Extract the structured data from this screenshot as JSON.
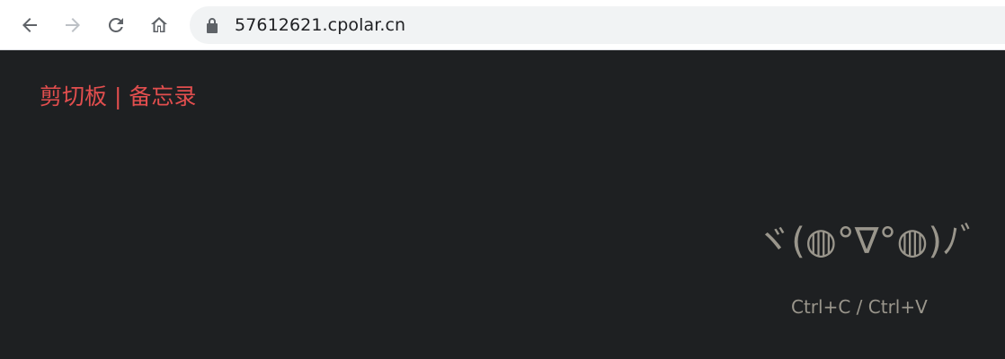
{
  "browser": {
    "url": "57612621.cpolar.cn",
    "icons": [
      "back-arrow-icon",
      "forward-arrow-icon",
      "reload-icon",
      "home-icon",
      "lock-icon"
    ]
  },
  "page": {
    "brand_title": "剪切板 | 备忘录",
    "kaomoji": "ヾ(◍°∇°◍)ﾉﾞ",
    "shortcut_hint": "Ctrl+C / Ctrl+V"
  },
  "colors": {
    "background": "#1e2022",
    "brand": "#e24e4e",
    "muted_text": "#9a968c"
  }
}
